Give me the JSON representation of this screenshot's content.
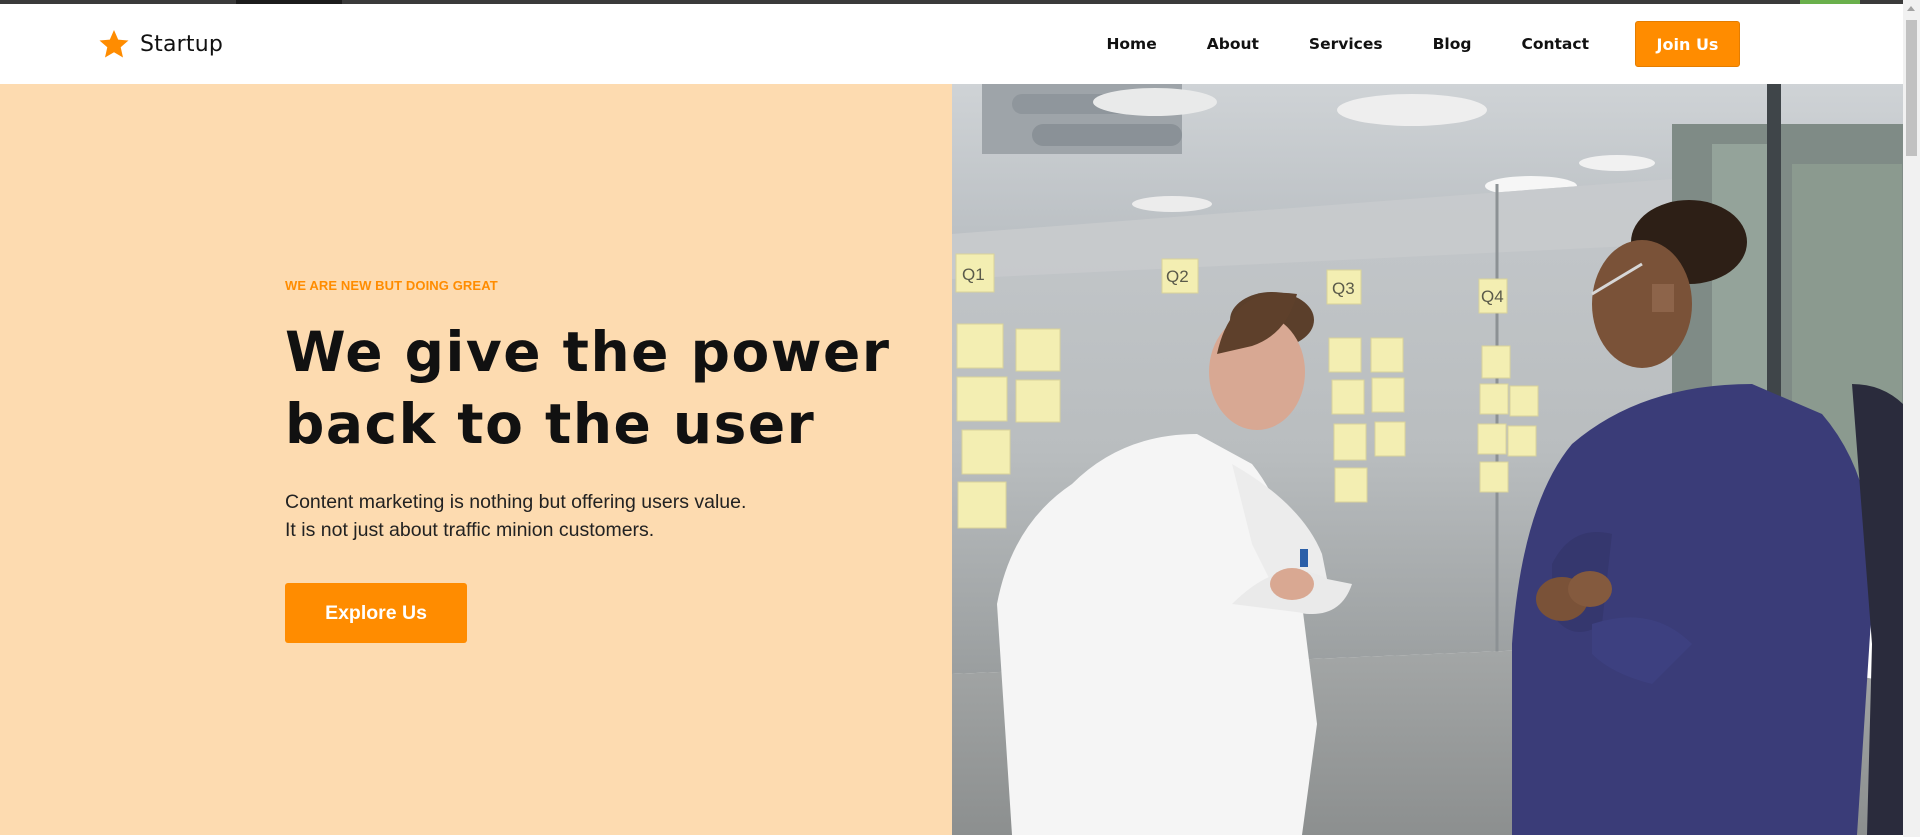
{
  "brand": {
    "name": "Startup",
    "icon": "star-icon",
    "accent": "#ff8c00"
  },
  "nav": {
    "items": [
      {
        "label": "Home"
      },
      {
        "label": "About"
      },
      {
        "label": "Services"
      },
      {
        "label": "Blog"
      },
      {
        "label": "Contact"
      }
    ],
    "cta_label": "Join Us"
  },
  "hero": {
    "eyebrow": "WE ARE NEW BUT DOING GREAT",
    "headline": [
      "We give the power",
      "back to the user"
    ],
    "subtext": [
      "Content marketing is nothing but offering users value.",
      "It is not just about traffic minion customers."
    ],
    "button_label": "Explore Us",
    "background_color": "#fddbb0",
    "image": {
      "sticky_note_labels": [
        "Q1",
        "Q2",
        "Q3",
        "Q4"
      ]
    }
  },
  "colors": {
    "accent": "#ff8c00",
    "text": "#111111",
    "hero_bg": "#fddbb0"
  }
}
